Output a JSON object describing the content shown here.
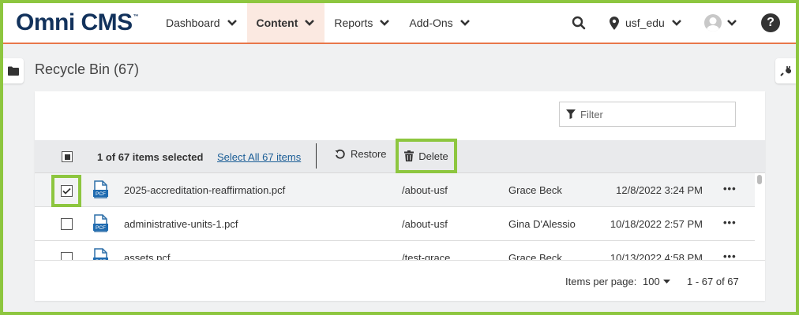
{
  "header": {
    "logo": "Omni CMS",
    "logo_mark": "™",
    "nav": [
      {
        "label": "Dashboard"
      },
      {
        "label": "Content"
      },
      {
        "label": "Reports"
      },
      {
        "label": "Add-Ons"
      }
    ],
    "account": "usf_edu",
    "help": "?"
  },
  "page": {
    "title": "Recycle Bin (67)"
  },
  "filter": {
    "placeholder": "Filter"
  },
  "toolbar": {
    "selected_count": "1 of 67 items selected",
    "select_all": "Select All 67 items",
    "restore_label": "Restore",
    "delete_label": "Delete"
  },
  "rows": [
    {
      "name": "2025-accreditation-reaffirmation.pcf",
      "path": "/about-usf",
      "user": "Grace Beck",
      "date": "12/8/2022 3:24 PM",
      "more": "•••",
      "checked": true
    },
    {
      "name": "administrative-units-1.pcf",
      "path": "/about-usf",
      "user": "Gina D'Alessio",
      "date": "10/18/2022 2:57 PM",
      "more": "•••",
      "checked": false
    },
    {
      "name": "assets.pcf",
      "path": "/test-grace",
      "user": "Grace Beck",
      "date": "10/13/2022 4:58 PM",
      "more": "•••",
      "checked": false
    }
  ],
  "file_icon_label": "PCF",
  "footer": {
    "items_per_page_label": "Items per page:",
    "items_per_page_value": "100",
    "range": "1 - 67 of 67"
  },
  "colors": {
    "highlight": "#8dc63f",
    "brand": "#12325c",
    "accent_line": "#e8774a",
    "link": "#1a5d96"
  }
}
